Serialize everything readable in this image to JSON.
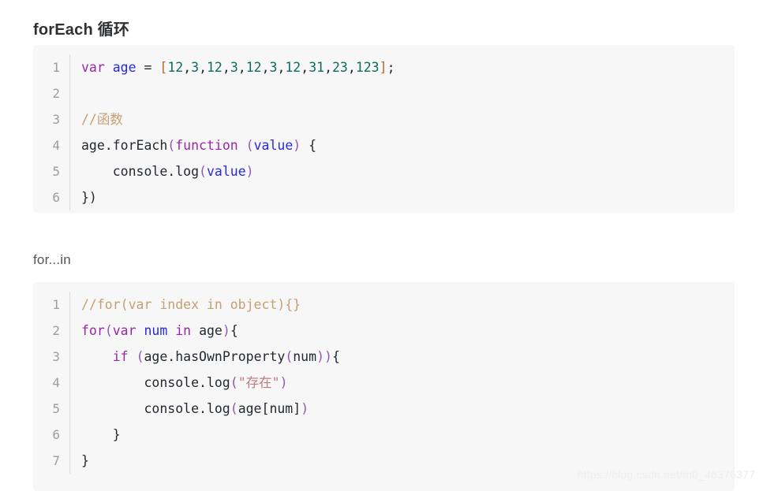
{
  "page": {
    "background_color": "#ffffff",
    "watermark": "https://blog.csdn.net/m0_46376377"
  },
  "headings": {
    "section_1": "forEach 循环",
    "section_2": "for...in"
  },
  "theme": {
    "code_background": "#f7f7f8",
    "line_number_color": "#9b9da1",
    "keyword_color": "#9a26a8",
    "variable_color": "#2727e6",
    "number_color": "#0b6e5c",
    "bracket_color": "#b36b2a",
    "comment_color": "#c5a070",
    "string_color": "#c07b7f",
    "text_color": "#24292e"
  },
  "code_blocks": [
    {
      "id": "foreach-block",
      "language": "javascript",
      "lines": [
        {
          "number": "1",
          "text": "var age = [12,3,12,3,12,3,12,31,23,123];",
          "tokens": [
            {
              "t": "var",
              "c": "kw"
            },
            {
              "t": " ",
              "c": "plain"
            },
            {
              "t": "age",
              "c": "var"
            },
            {
              "t": " ",
              "c": "plain"
            },
            {
              "t": "=",
              "c": "punc"
            },
            {
              "t": " ",
              "c": "plain"
            },
            {
              "t": "[",
              "c": "brk"
            },
            {
              "t": "12",
              "c": "num"
            },
            {
              "t": ",",
              "c": "punc"
            },
            {
              "t": "3",
              "c": "num"
            },
            {
              "t": ",",
              "c": "punc"
            },
            {
              "t": "12",
              "c": "num"
            },
            {
              "t": ",",
              "c": "punc"
            },
            {
              "t": "3",
              "c": "num"
            },
            {
              "t": ",",
              "c": "punc"
            },
            {
              "t": "12",
              "c": "num"
            },
            {
              "t": ",",
              "c": "punc"
            },
            {
              "t": "3",
              "c": "num"
            },
            {
              "t": ",",
              "c": "punc"
            },
            {
              "t": "12",
              "c": "num"
            },
            {
              "t": ",",
              "c": "punc"
            },
            {
              "t": "31",
              "c": "num"
            },
            {
              "t": ",",
              "c": "punc"
            },
            {
              "t": "23",
              "c": "num"
            },
            {
              "t": ",",
              "c": "punc"
            },
            {
              "t": "123",
              "c": "num"
            },
            {
              "t": "]",
              "c": "brk"
            },
            {
              "t": ";",
              "c": "punc"
            }
          ]
        },
        {
          "number": "2",
          "text": "",
          "tokens": []
        },
        {
          "number": "3",
          "text": "//函数",
          "tokens": [
            {
              "t": "//函数",
              "c": "comment"
            }
          ]
        },
        {
          "number": "4",
          "text": "age.forEach(function (value) {",
          "tokens": [
            {
              "t": "age.forEach",
              "c": "plain"
            },
            {
              "t": "(",
              "c": "paren"
            },
            {
              "t": "function",
              "c": "kw"
            },
            {
              "t": " ",
              "c": "plain"
            },
            {
              "t": "(",
              "c": "paren"
            },
            {
              "t": "value",
              "c": "var"
            },
            {
              "t": ")",
              "c": "paren"
            },
            {
              "t": " {",
              "c": "plain"
            }
          ]
        },
        {
          "number": "5",
          "text": "    console.log(value)",
          "tokens": [
            {
              "t": "    console.log",
              "c": "plain"
            },
            {
              "t": "(",
              "c": "paren"
            },
            {
              "t": "value",
              "c": "var"
            },
            {
              "t": ")",
              "c": "paren"
            }
          ]
        },
        {
          "number": "6",
          "text": "})",
          "tokens": [
            {
              "t": "})",
              "c": "plain"
            }
          ]
        }
      ]
    },
    {
      "id": "forin-block",
      "language": "javascript",
      "lines": [
        {
          "number": "1",
          "text": "//for(var index in object){}",
          "tokens": [
            {
              "t": "//for(var index in object){}",
              "c": "comment"
            }
          ]
        },
        {
          "number": "2",
          "text": "for(var num in age){",
          "tokens": [
            {
              "t": "for",
              "c": "kw"
            },
            {
              "t": "(",
              "c": "paren"
            },
            {
              "t": "var",
              "c": "kw"
            },
            {
              "t": " ",
              "c": "plain"
            },
            {
              "t": "num",
              "c": "var"
            },
            {
              "t": " ",
              "c": "plain"
            },
            {
              "t": "in",
              "c": "kw"
            },
            {
              "t": " ",
              "c": "plain"
            },
            {
              "t": "age",
              "c": "plain"
            },
            {
              "t": ")",
              "c": "paren"
            },
            {
              "t": "{",
              "c": "plain"
            }
          ]
        },
        {
          "number": "3",
          "text": "    if (age.hasOwnProperty(num)){",
          "tokens": [
            {
              "t": "    ",
              "c": "plain"
            },
            {
              "t": "if",
              "c": "kw"
            },
            {
              "t": " ",
              "c": "plain"
            },
            {
              "t": "(",
              "c": "paren"
            },
            {
              "t": "age.hasOwnProperty",
              "c": "plain"
            },
            {
              "t": "(",
              "c": "paren"
            },
            {
              "t": "num",
              "c": "plain"
            },
            {
              "t": ")",
              "c": "paren"
            },
            {
              "t": ")",
              "c": "paren"
            },
            {
              "t": "{",
              "c": "plain"
            }
          ]
        },
        {
          "number": "4",
          "text": "        console.log(\"存在\")",
          "tokens": [
            {
              "t": "        console.log",
              "c": "plain"
            },
            {
              "t": "(",
              "c": "paren"
            },
            {
              "t": "\"存在\"",
              "c": "str"
            },
            {
              "t": ")",
              "c": "paren"
            }
          ]
        },
        {
          "number": "5",
          "text": "        console.log(age[num])",
          "tokens": [
            {
              "t": "        console.log",
              "c": "plain"
            },
            {
              "t": "(",
              "c": "paren"
            },
            {
              "t": "age",
              "c": "plain"
            },
            {
              "t": "[",
              "c": "plain"
            },
            {
              "t": "num",
              "c": "plain"
            },
            {
              "t": "]",
              "c": "plain"
            },
            {
              "t": ")",
              "c": "paren"
            }
          ]
        },
        {
          "number": "6",
          "text": "    }",
          "tokens": [
            {
              "t": "    }",
              "c": "plain"
            }
          ]
        },
        {
          "number": "7",
          "text": "}",
          "tokens": [
            {
              "t": "}",
              "c": "plain"
            }
          ]
        }
      ]
    }
  ]
}
